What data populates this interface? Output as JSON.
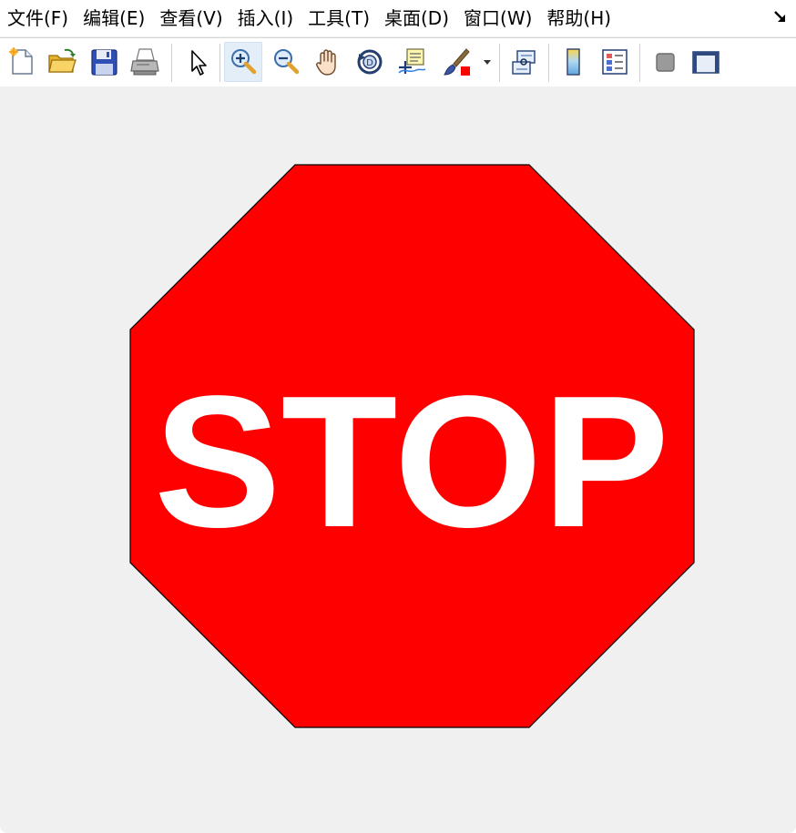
{
  "menubar": {
    "items": [
      {
        "label": "文件(F)"
      },
      {
        "label": "编辑(E)"
      },
      {
        "label": "查看(V)"
      },
      {
        "label": "插入(I)"
      },
      {
        "label": "工具(T)"
      },
      {
        "label": "桌面(D)"
      },
      {
        "label": "窗口(W)"
      },
      {
        "label": "帮助(H)"
      }
    ],
    "dock_icon": "undock-arrow-icon"
  },
  "toolbar": {
    "buttons": [
      {
        "icon": "new-figure-icon"
      },
      {
        "icon": "open-file-icon"
      },
      {
        "icon": "save-icon"
      },
      {
        "icon": "print-icon"
      },
      {
        "icon": "pointer-arrow-icon"
      },
      {
        "icon": "zoom-in-icon",
        "active": true
      },
      {
        "icon": "zoom-out-icon"
      },
      {
        "icon": "pan-hand-icon"
      },
      {
        "icon": "rotate-3d-icon"
      },
      {
        "icon": "data-cursor-icon"
      },
      {
        "icon": "brush-icon"
      },
      {
        "icon": "brush-dropdown-icon"
      },
      {
        "icon": "link-plot-icon"
      },
      {
        "icon": "colorbar-icon"
      },
      {
        "icon": "legend-icon"
      },
      {
        "icon": "hide-plot-tools-icon"
      },
      {
        "icon": "show-plot-tools-icon"
      }
    ]
  },
  "figure": {
    "sign_text": "STOP",
    "sign_fill": "#ff0000",
    "text_color": "#ffffff",
    "edge_color": "#000000",
    "background": "#f0f0f0"
  }
}
